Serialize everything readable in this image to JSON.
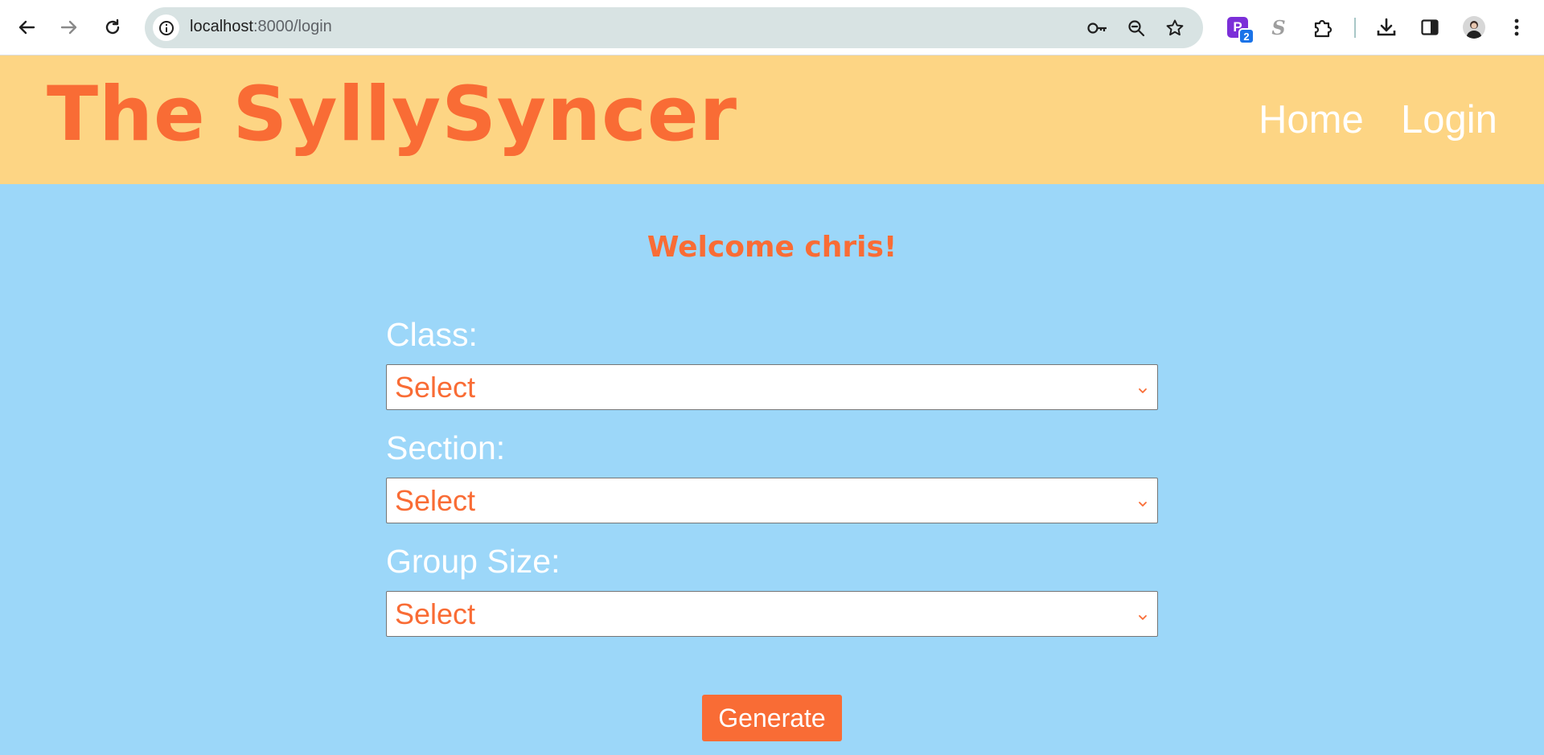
{
  "browser": {
    "url_host": "localhost",
    "url_path": ":8000/login",
    "extension_badge": "2",
    "extension_p_letter": "P",
    "extension_s_letter": "S",
    "icons": [
      "back-icon",
      "forward-icon",
      "reload-icon",
      "site-info-icon",
      "key-icon",
      "zoom-icon",
      "star-icon",
      "puzzle-icon",
      "download-icon",
      "side-panel-icon",
      "avatar",
      "kebab-menu-icon"
    ]
  },
  "header": {
    "title": "The SyllySyncer",
    "nav": {
      "home": "Home",
      "login": "Login"
    }
  },
  "main": {
    "welcome": "Welcome chris!",
    "fields": {
      "class_label": "Class:",
      "class_value": "Select",
      "section_label": "Section:",
      "section_value": "Select",
      "group_size_label": "Group Size:",
      "group_size_value": "Select"
    },
    "generate_label": "Generate"
  },
  "colors": {
    "header_bg": "#fdd584",
    "main_bg": "#9cd7f9",
    "accent": "#f96c35",
    "label": "#ffffff"
  }
}
